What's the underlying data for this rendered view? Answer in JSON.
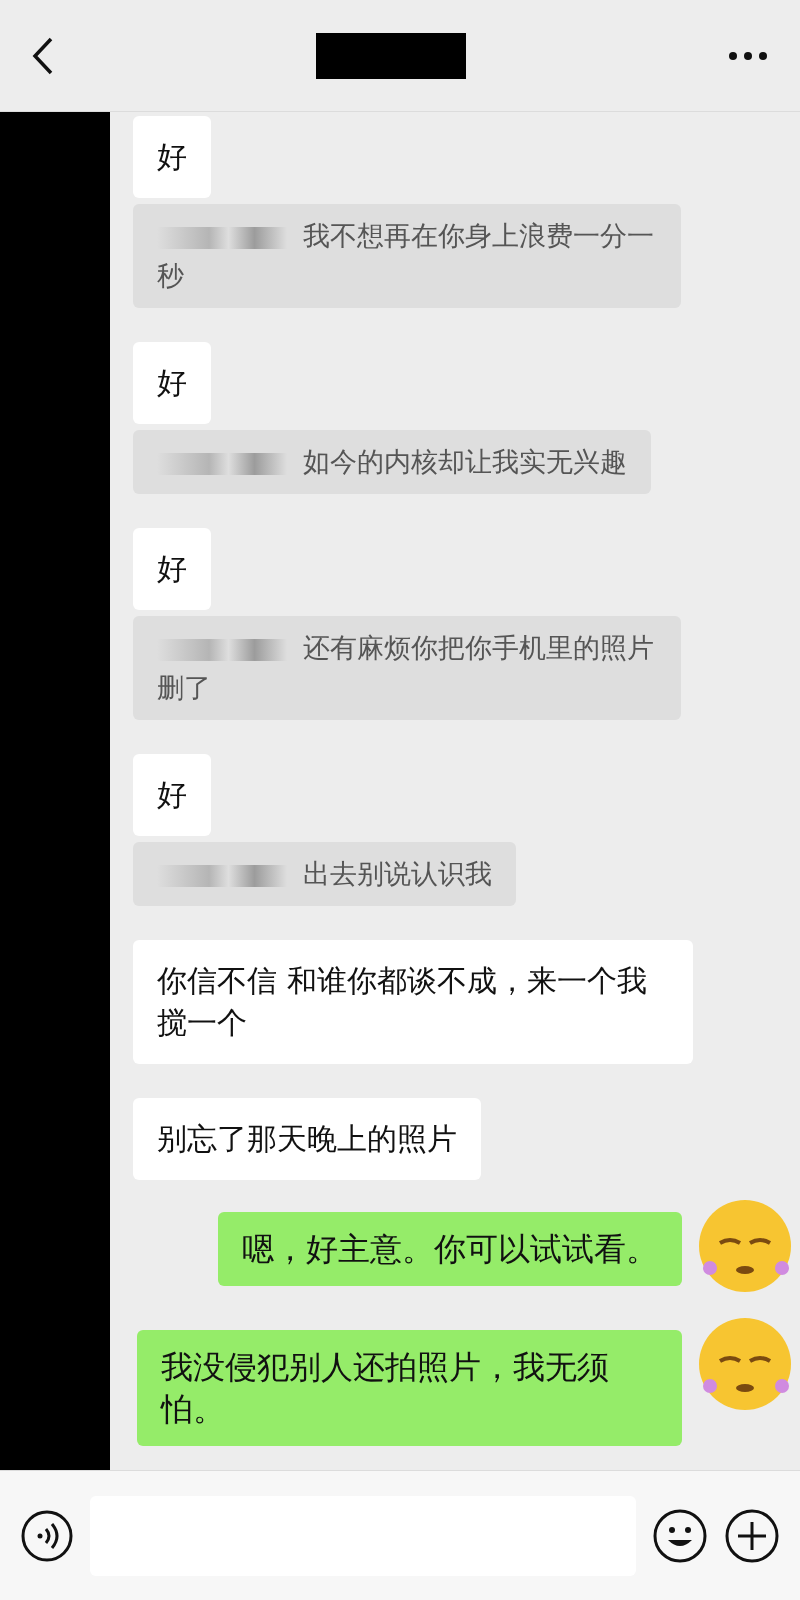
{
  "messages": [
    {
      "kind": "incoming",
      "text": "好",
      "quote": "我不想再在你身上浪费一分一秒"
    },
    {
      "kind": "incoming",
      "text": "好",
      "quote": "如今的内核却让我实无兴趣"
    },
    {
      "kind": "incoming",
      "text": "好",
      "quote": "还有麻烦你把你手机里的照片删了"
    },
    {
      "kind": "incoming",
      "text": "好",
      "quote": "出去别说认识我"
    },
    {
      "kind": "incoming",
      "text": "你信不信 和谁你都谈不成，来一个我搅一个"
    },
    {
      "kind": "incoming",
      "text": "别忘了那天晚上的照片"
    },
    {
      "kind": "outgoing",
      "text": "嗯，好主意。你可以试试看。"
    },
    {
      "kind": "outgoing",
      "text": "我没侵犯别人还拍照片，我无须怕。"
    }
  ]
}
